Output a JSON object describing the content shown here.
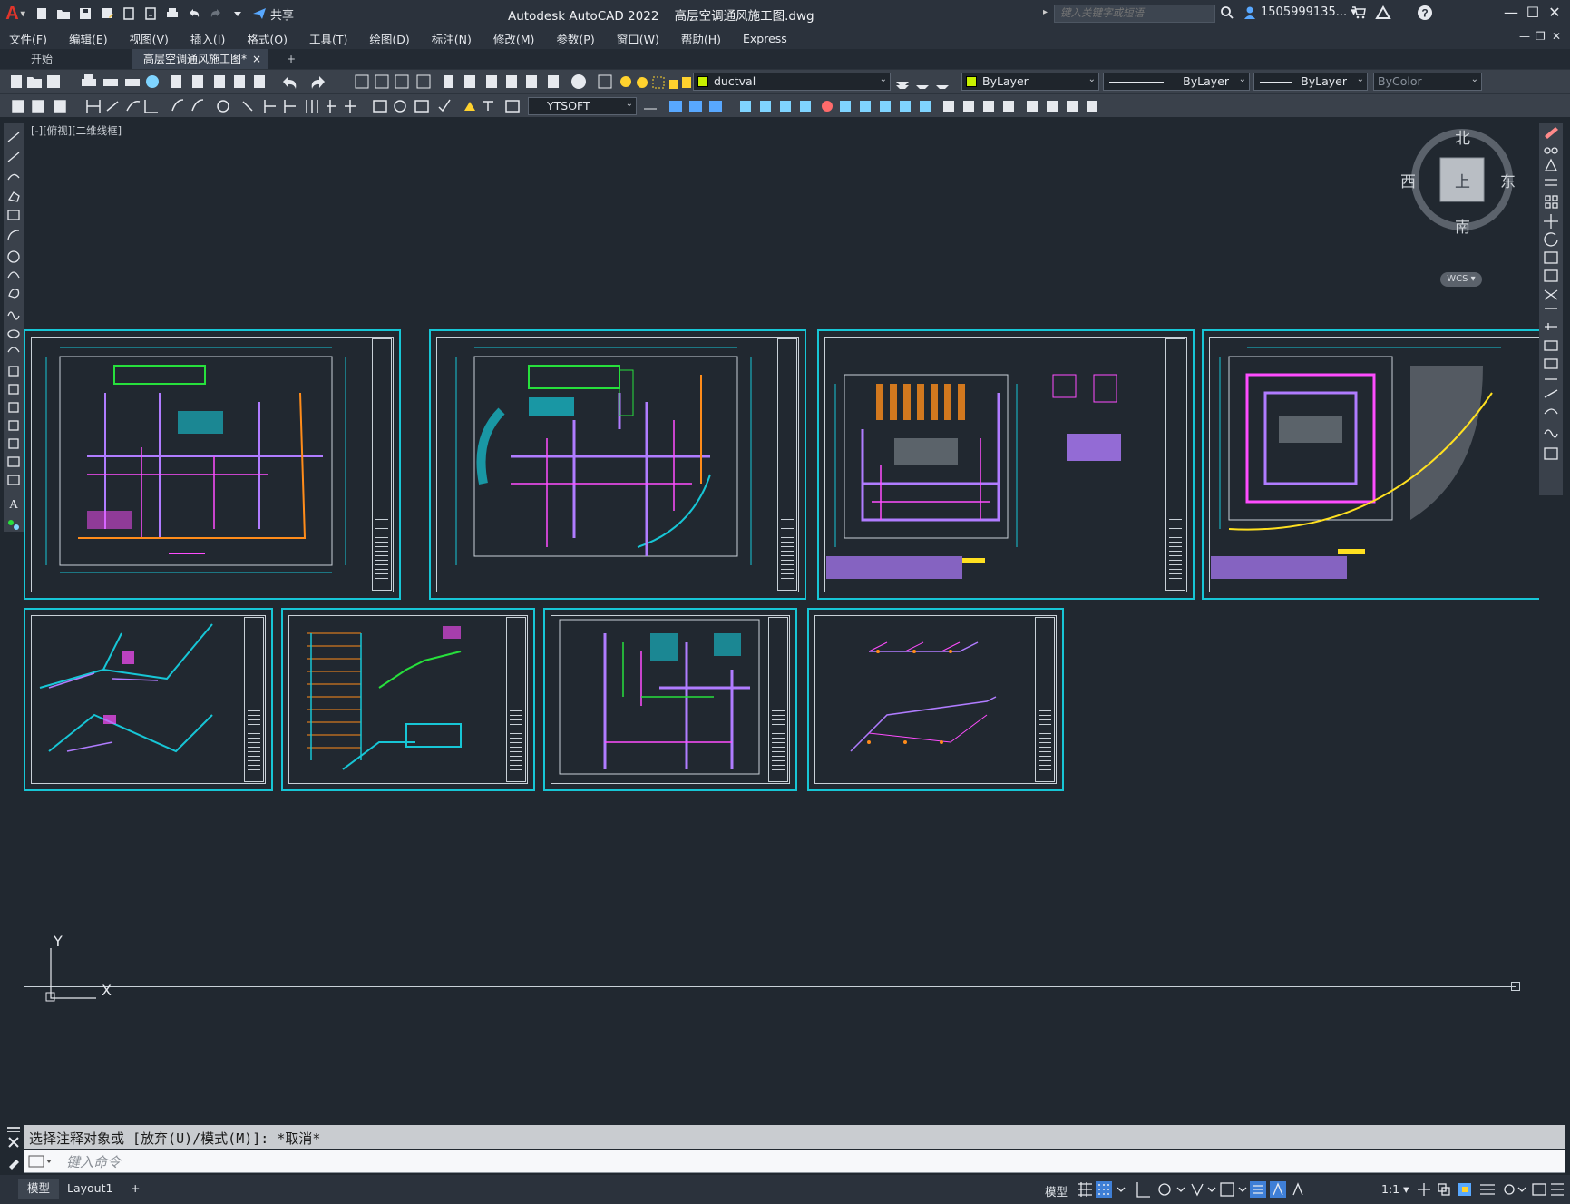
{
  "titlebar": {
    "app_logo": "A",
    "share_label": "共享",
    "app_title": "Autodesk AutoCAD 2022",
    "file_name": "高层空调通风施工图.dwg",
    "search_placeholder": "键入关键字或短语",
    "user_name": "1505999135..."
  },
  "menu": [
    "文件(F)",
    "编辑(E)",
    "视图(V)",
    "插入(I)",
    "格式(O)",
    "工具(T)",
    "绘图(D)",
    "标注(N)",
    "修改(M)",
    "参数(P)",
    "窗口(W)",
    "帮助(H)",
    "Express"
  ],
  "tabs": {
    "start": "开始",
    "active": "高层空调通风施工图*",
    "close": "×",
    "add": "+"
  },
  "toolbar": {
    "layer_name": "ductval",
    "layer_color": "#c8f000",
    "color_combo": "ByLayer",
    "linetype_combo": "ByLayer",
    "lineweight_combo": "ByLayer",
    "plotstyle_combo": "ByColor",
    "textstyle_combo": "YTSOFT"
  },
  "viewport": {
    "view_label": "[-][俯视][二维线框]",
    "compass": {
      "north": "北",
      "south": "南",
      "east": "东",
      "west": "西",
      "top": "上"
    },
    "wcs_label": "WCS",
    "ucs": {
      "x": "X",
      "y": "Y"
    }
  },
  "command": {
    "history": "选择注释对象或 [放弃(U)/模式(M)]: *取消*",
    "placeholder": "键入命令"
  },
  "status": {
    "model_tab": "模型",
    "layout_tab": "Layout1",
    "add_tab": "+",
    "model_label": "模型",
    "scale": "1:1"
  },
  "colors": {
    "accent_cyan": "#17c6d6",
    "magenta": "#ff4dff",
    "purple": "#b07cff",
    "green": "#27e03c",
    "orange": "#ff8c1a",
    "yellow": "#ffe020"
  }
}
